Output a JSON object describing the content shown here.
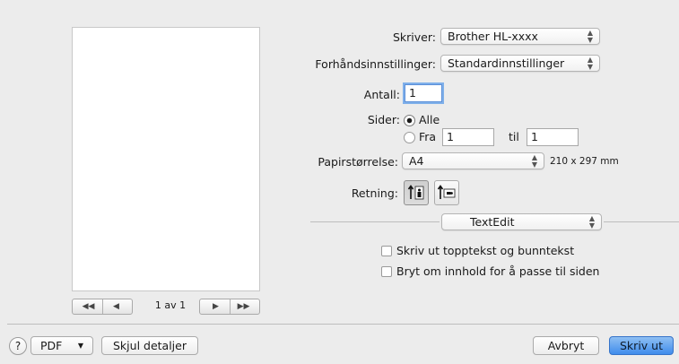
{
  "preview": {
    "page_label": "1 av 1",
    "nav_first_icon": "first-page-icon",
    "nav_prev_icon": "previous-page-icon",
    "nav_next_icon": "next-page-icon",
    "nav_last_icon": "last-page-icon"
  },
  "printer": {
    "label": "Skriver:",
    "value": "Brother HL-xxxx"
  },
  "presets": {
    "label": "Forhåndsinnstillinger:",
    "value": "Standardinnstillinger"
  },
  "copies": {
    "label": "Antall:",
    "value": "1"
  },
  "pages": {
    "label": "Sider:",
    "all_label": "Alle",
    "from_label": "Fra",
    "from_value": "1",
    "to_label": "til",
    "to_value": "1",
    "selected": "Alle"
  },
  "paper_size": {
    "label": "Papirstørrelse:",
    "value": "A4",
    "dimensions": "210 x 297 mm"
  },
  "orientation": {
    "label": "Retning:",
    "portrait_icon": "portrait-orientation-icon",
    "landscape_icon": "landscape-orientation-icon",
    "selected": "portrait"
  },
  "section_popup": {
    "value": "TextEdit"
  },
  "options": [
    {
      "label": "Skriv ut topptekst og bunntekst",
      "checked": false
    },
    {
      "label": "Bryt om innhold for å passe til siden",
      "checked": false
    }
  ],
  "footer": {
    "help_label": "?",
    "pdf_label": "PDF",
    "hide_details_label": "Skjul detaljer",
    "cancel_label": "Avbryt",
    "print_label": "Skriv ut"
  },
  "colors": {
    "accent": "#3f8cec",
    "background": "#ececec"
  }
}
